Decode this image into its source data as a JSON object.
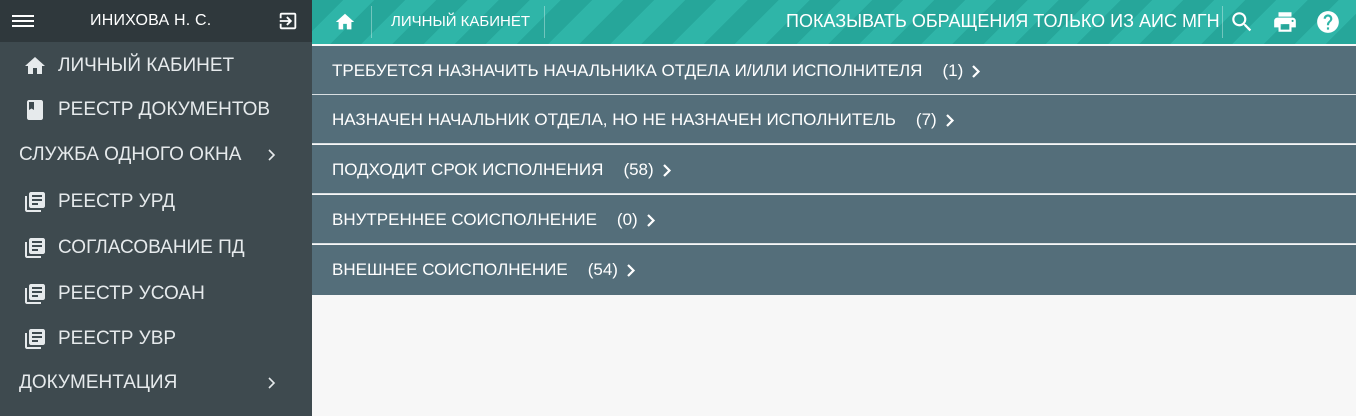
{
  "user": {
    "name": "ИНИХОВА Н. С."
  },
  "sidebar": {
    "items": [
      {
        "label": "ЛИЧНЫЙ КАБИНЕТ",
        "icon": "home-icon"
      },
      {
        "label": "РЕЕСТР ДОКУМЕНТОВ",
        "icon": "book-icon"
      },
      {
        "label": "СЛУЖБА ОДНОГО ОКНА",
        "icon": "chevron-right-icon",
        "group": true
      },
      {
        "label": "РЕЕСТР УРД",
        "icon": "library-books-icon"
      },
      {
        "label": "СОГЛАСОВАНИЕ ПД",
        "icon": "library-books-icon"
      },
      {
        "label": "РЕЕСТР УСОАН",
        "icon": "library-books-icon"
      },
      {
        "label": "РЕЕСТР УВР",
        "icon": "library-books-icon"
      },
      {
        "label": "ДОКУМЕНТАЦИЯ",
        "icon": "chevron-right-icon",
        "group": true
      }
    ]
  },
  "header": {
    "breadcrumb": "ЛИЧНЫЙ КАБИНЕТ",
    "filter_label": "ПОКАЗЫВАТЬ ОБРАЩЕНИЯ ТОЛЬКО ИЗ АИС МГН",
    "icons": [
      "search-icon",
      "print-icon",
      "help-icon"
    ]
  },
  "sections": [
    {
      "label": "ТРЕБУЕТСЯ НАЗНАЧИТЬ НАЧАЛЬНИКА ОТДЕЛА И/ИЛИ ИСПОЛНИТЕЛЯ",
      "count": "(1)"
    },
    {
      "label": "НАЗНАЧЕН НАЧАЛЬНИК ОТДЕЛА, НО НЕ НАЗНАЧЕН ИСПОЛНИТЕЛЬ",
      "count": "(7)"
    },
    {
      "label": "ПОДХОДИТ СРОК ИСПОЛНЕНИЯ",
      "count": "(58)"
    },
    {
      "label": "ВНУТРЕННЕЕ СОИСПОЛНЕНИЕ",
      "count": "(0)"
    },
    {
      "label": "ВНЕШНЕЕ СОИСПОЛНЕНИЕ",
      "count": "(54)"
    }
  ],
  "colors": {
    "sidebar_bg": "#3e4a4f",
    "header_accent": "#26a69a",
    "row_bg": "#546e7a",
    "content_bg": "#f7f7f7"
  }
}
